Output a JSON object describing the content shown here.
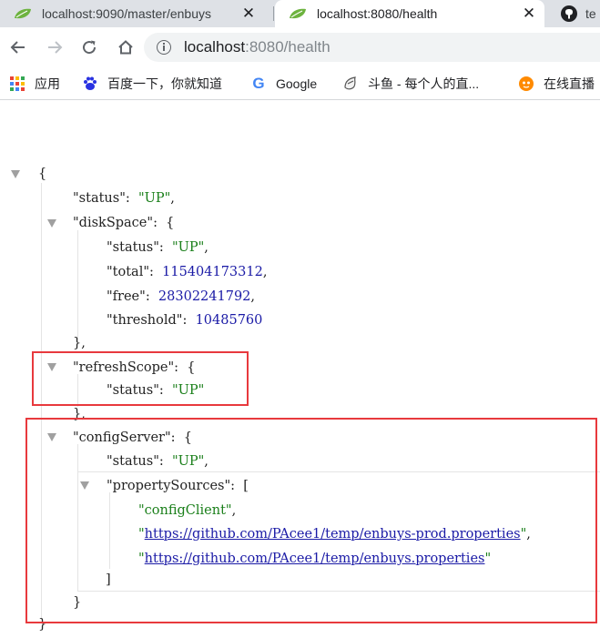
{
  "tabs": [
    {
      "title": "localhost:9090/master/enbuys",
      "icon": "spring-leaf-icon",
      "close": "✕"
    },
    {
      "title": "localhost:8080/health",
      "icon": "spring-leaf-icon",
      "close": "✕",
      "active": true
    },
    {
      "title": "te",
      "icon": "github-icon"
    }
  ],
  "address_bar": {
    "host": "localhost",
    "rest": ":8080/health"
  },
  "bookmarks": [
    {
      "label": "应用",
      "icon": "apps-grid-icon"
    },
    {
      "label": "百度一下，你就知道",
      "icon": "baidu-paw-icon"
    },
    {
      "label": "Google",
      "icon": "google-icon"
    },
    {
      "label": "斗鱼 - 每个人的直...",
      "icon": "douyu-icon"
    },
    {
      "label": "在线直播",
      "icon": "live-stream-icon"
    }
  ],
  "json": {
    "open_brace": "{",
    "status_key": "\"status\"",
    "status_val": "\"UP\"",
    "diskSpace_key": "\"diskSpace\"",
    "disk_status_key": "\"status\"",
    "disk_status_val": "\"UP\"",
    "total_key": "\"total\"",
    "total_val": "115404173312",
    "free_key": "\"free\"",
    "free_val": "28302241792",
    "threshold_key": "\"threshold\"",
    "threshold_val": "10485760",
    "refreshScope_key": "\"refreshScope\"",
    "refresh_status_key": "\"status\"",
    "refresh_status_val": "\"UP\"",
    "configServer_key": "\"configServer\"",
    "config_status_key": "\"status\"",
    "config_status_val": "\"UP\"",
    "propertySources_key": "\"propertySources\"",
    "ps_0": "\"configClient\"",
    "ps_1": "https://github.com/PAcee1/temp/enbuys-prod.properties",
    "ps_2": "https://github.com/PAcee1/temp/enbuys.properties",
    "close_bracket": "]",
    "close_brace": "}"
  },
  "colors": {
    "highlight_box": "#e8393d",
    "string": "#1a7f1a",
    "number": "#1a1aa6"
  }
}
